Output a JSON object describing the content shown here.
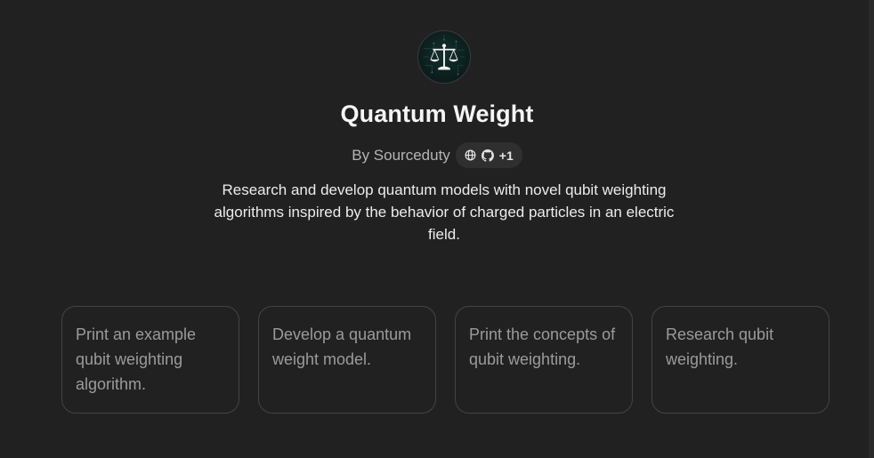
{
  "gpt": {
    "name": "Quantum Weight",
    "author_label": "By Sourceduty",
    "description": "Research and develop quantum models with novel qubit weighting algorithms inspired by the behavior of charged particles in an electric field.",
    "avatar_icon": "balance-scale-icon"
  },
  "badge": {
    "icons": [
      "globe-icon",
      "github-icon"
    ],
    "more_label": "+1"
  },
  "conversation_starters": [
    {
      "text": "Print an example qubit weighting algorithm."
    },
    {
      "text": "Develop a quantum weight model."
    },
    {
      "text": "Print the concepts of qubit weighting."
    },
    {
      "text": "Research qubit weighting."
    }
  ],
  "colors": {
    "background": "#212121",
    "card_border": "#444444",
    "starter_text": "#9b9b9b",
    "badge_bg": "#2f2f2f"
  }
}
